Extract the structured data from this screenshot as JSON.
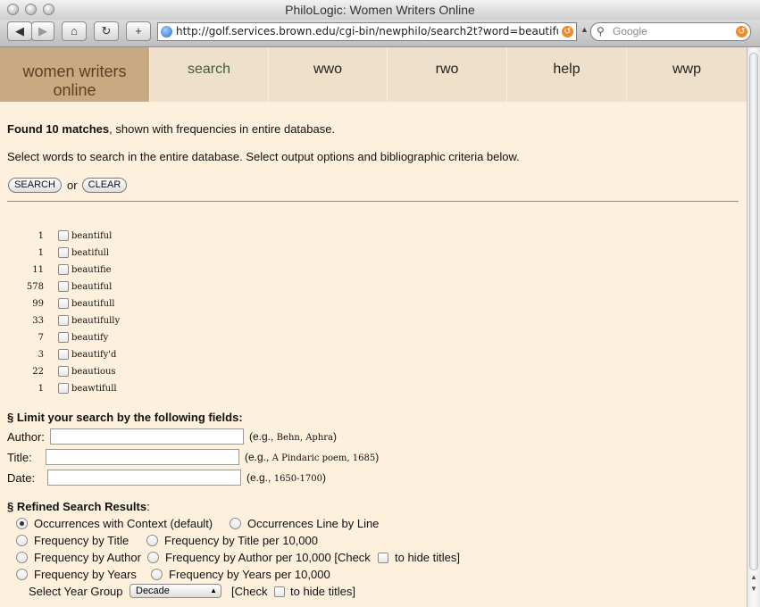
{
  "window": {
    "title": "PhiloLogic: Women Writers Online"
  },
  "toolbar": {
    "url": "http://golf.services.brown.edu/cgi-bin/newphilo/search2t?word=beautifu",
    "search_placeholder": "Google"
  },
  "nav": {
    "logo": [
      "women writers",
      "online"
    ],
    "tabs": [
      "search",
      "wwo",
      "rwo",
      "help",
      "wwp"
    ]
  },
  "results": {
    "found_bold": "Found 10 matches",
    "found_rest": ", shown with frequencies in entire database.",
    "instructions": "Select words to search in the entire database. Select output options and bibliographic criteria below.",
    "search_label": "SEARCH",
    "or_label": "or",
    "clear_label": "CLEAR",
    "words": [
      {
        "count": "1",
        "word": "beantiful"
      },
      {
        "count": "1",
        "word": "beatifull"
      },
      {
        "count": "11",
        "word": "beautifie"
      },
      {
        "count": "578",
        "word": "beautiful"
      },
      {
        "count": "99",
        "word": "beautifull"
      },
      {
        "count": "33",
        "word": "beautifully"
      },
      {
        "count": "7",
        "word": "beautify"
      },
      {
        "count": "3",
        "word": "beautify'd"
      },
      {
        "count": "22",
        "word": "beautious"
      },
      {
        "count": "1",
        "word": "beawtifull"
      }
    ]
  },
  "limit": {
    "heading": "§ Limit your search by the following fields:",
    "author_label": "Author:",
    "author_eg_prefix": "(e.g.,",
    "author_eg": "Behn, Aphra",
    "author_eg_suffix": ")",
    "title_label": "Title:",
    "title_eg_prefix": "(e.g.,",
    "title_eg": "A Pindaric poem, 1685",
    "title_eg_suffix": ")",
    "date_label": "Date:",
    "date_eg_prefix": "(e.g.,",
    "date_eg": "1650-1700",
    "date_eg_suffix": ")"
  },
  "refined": {
    "heading_bold": "§ Refined Search Results",
    "heading_colon": ":",
    "opt_context": "Occurrences with Context (default)",
    "opt_line": "Occurrences Line by Line",
    "opt_freq_title": "Frequency by Title",
    "opt_freq_title_10k": "Frequency by Title per 10,000",
    "opt_freq_author": "Frequency by Author",
    "opt_freq_author_10k": "Frequency by Author per 10,000 [Check",
    "hide_titles": "to hide titles]",
    "opt_freq_years": "Frequency by Years",
    "opt_freq_years_10k": "Frequency by Years per 10,000",
    "year_group_label": "Select Year Group",
    "year_group_value": "Decade",
    "year_check": "[Check",
    "year_hide_titles": "to hide titles]"
  }
}
